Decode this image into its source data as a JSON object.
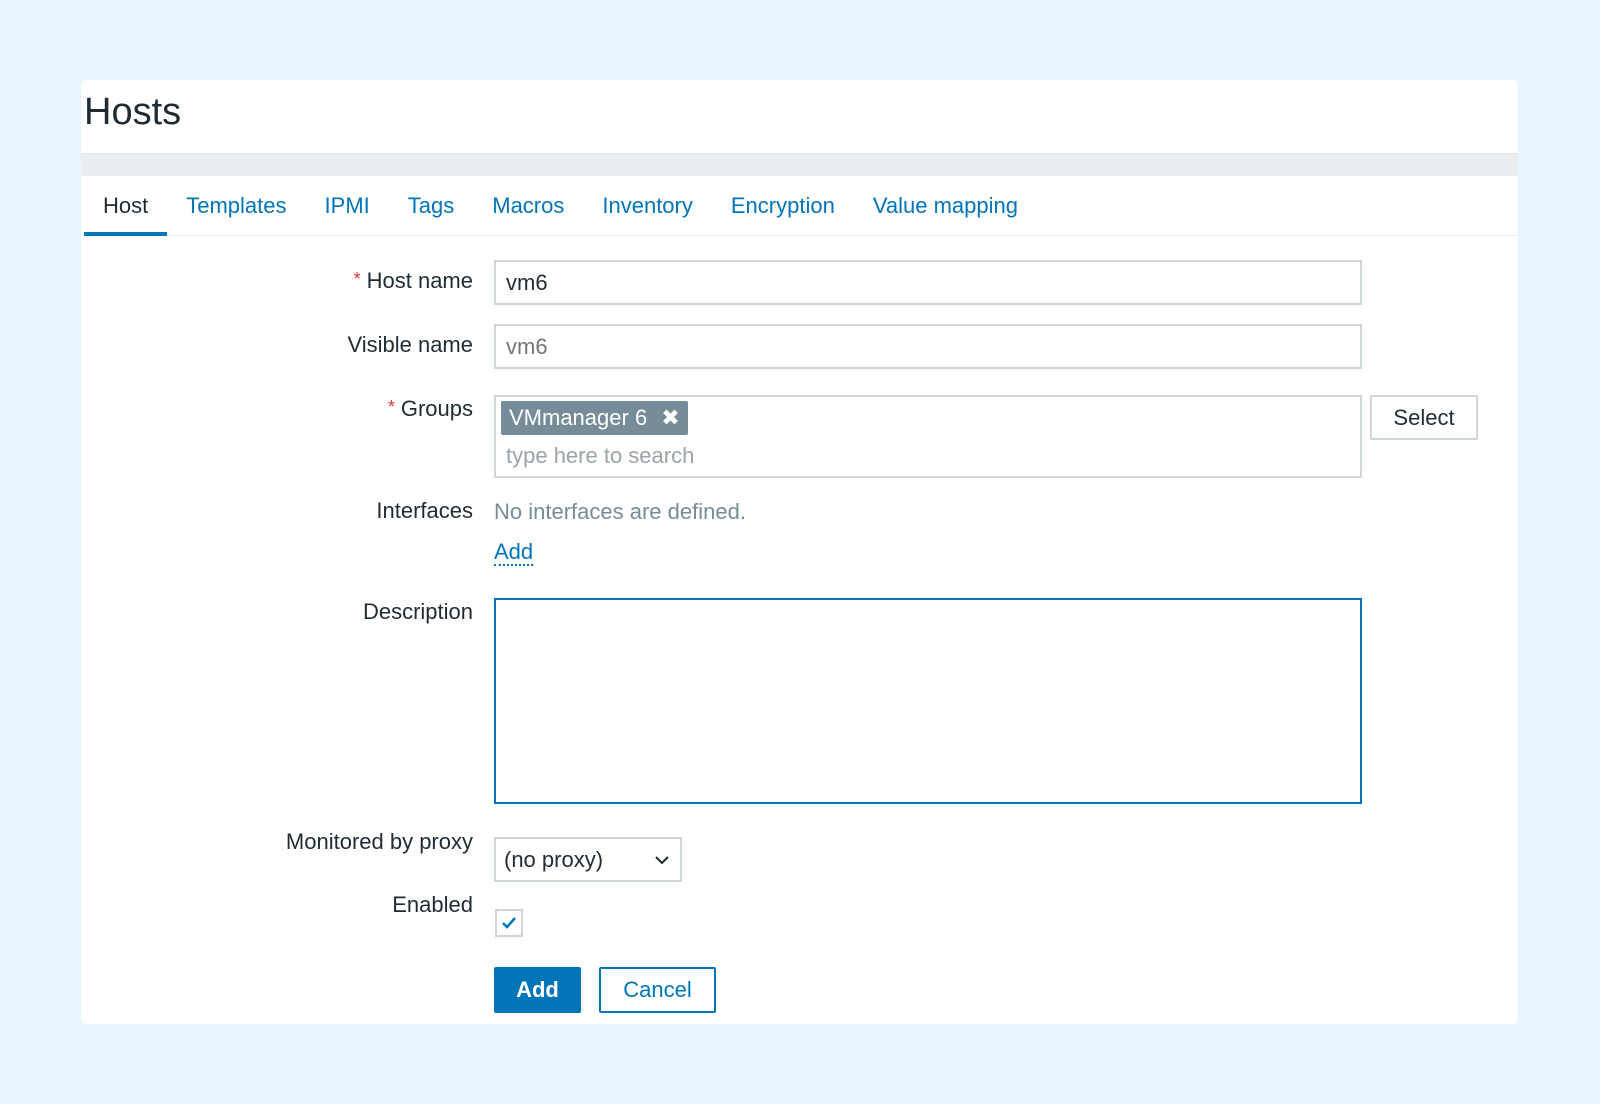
{
  "page": {
    "title": "Hosts"
  },
  "tabs": [
    {
      "label": "Host",
      "active": true
    },
    {
      "label": "Templates"
    },
    {
      "label": "IPMI"
    },
    {
      "label": "Tags"
    },
    {
      "label": "Macros"
    },
    {
      "label": "Inventory"
    },
    {
      "label": "Encryption"
    },
    {
      "label": "Value mapping"
    }
  ],
  "form": {
    "required_marker": "*",
    "host_name": {
      "label": "Host name",
      "value": "vm6"
    },
    "visible_name": {
      "label": "Visible name",
      "placeholder": "vm6"
    },
    "groups": {
      "label": "Groups",
      "chip": "VMmanager 6",
      "chip_remove": "✖",
      "search_placeholder": "type here to search",
      "select_button": "Select"
    },
    "interfaces": {
      "label": "Interfaces",
      "empty_text": "No interfaces are defined.",
      "add_link": "Add"
    },
    "description": {
      "label": "Description",
      "value": ""
    },
    "proxy": {
      "label": "Monitored by proxy",
      "value": "(no proxy)"
    },
    "enabled": {
      "label": "Enabled",
      "checked": true
    },
    "buttons": {
      "add": "Add",
      "cancel": "Cancel"
    }
  },
  "colors": {
    "accent": "#0275b8",
    "required": "#e33734",
    "chip_bg": "#768d99",
    "background": "#e8f5fd"
  }
}
